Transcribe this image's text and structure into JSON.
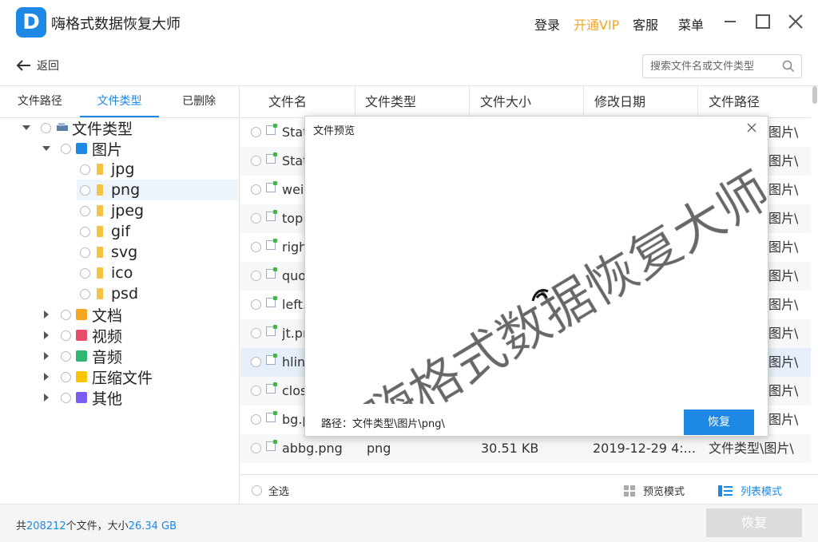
{
  "app": {
    "title": "嗨格式数据恢复大师"
  },
  "titlebar": {
    "login": "登录",
    "vip": "开通VIP",
    "service": "客服",
    "menu": "菜单"
  },
  "toolbar": {
    "back": "返回",
    "search_placeholder": "搜索文件名或文件类型"
  },
  "sidebar": {
    "tabs": [
      "文件路径",
      "文件类型",
      "已删除"
    ],
    "root": "文件类型",
    "images": "图片",
    "image_types": [
      "jpg",
      "png",
      "jpeg",
      "gif",
      "svg",
      "ico",
      "psd"
    ],
    "categories": [
      "文档",
      "视频",
      "音频",
      "压缩文件",
      "其他"
    ]
  },
  "table": {
    "headers": [
      "文件名",
      "文件类型",
      "文件大小",
      "修改日期",
      "文件路径"
    ],
    "rows": [
      {
        "name": "Stat",
        "path": "图片\\"
      },
      {
        "name": "Stat",
        "path": "图片\\"
      },
      {
        "name": "wei",
        "path": "图片\\"
      },
      {
        "name": "top",
        "path": "图片\\"
      },
      {
        "name": "righ",
        "path": "图片\\"
      },
      {
        "name": "quo",
        "path": "图片\\"
      },
      {
        "name": "left.",
        "path": "图片\\"
      },
      {
        "name": "jt.pr",
        "path": "图片\\"
      },
      {
        "name": "hlin",
        "path": "图片\\"
      },
      {
        "name": "clos",
        "path": "图片\\"
      },
      {
        "name": "bg.p",
        "path": "图片\\"
      },
      {
        "name": "abbg.png",
        "type": "png",
        "size": "30.51 KB",
        "date": "2019-12-29 4:...",
        "path": "文件类型\\图片\\"
      }
    ],
    "select_all": "全选",
    "preview_mode": "预览模式",
    "list_mode": "列表模式"
  },
  "footer": {
    "prefix": "共",
    "count": "208212",
    "mid": "个文件，大小",
    "size": "26.34 GB",
    "recover": "恢复"
  },
  "modal": {
    "title": "文件预览",
    "watermark": "嗨格式数据恢复大师",
    "path": "路径：文件类型\\图片\\png\\",
    "recover": "恢复"
  },
  "colors": {
    "accent": "#1e88e5",
    "vip": "#f5a623"
  }
}
